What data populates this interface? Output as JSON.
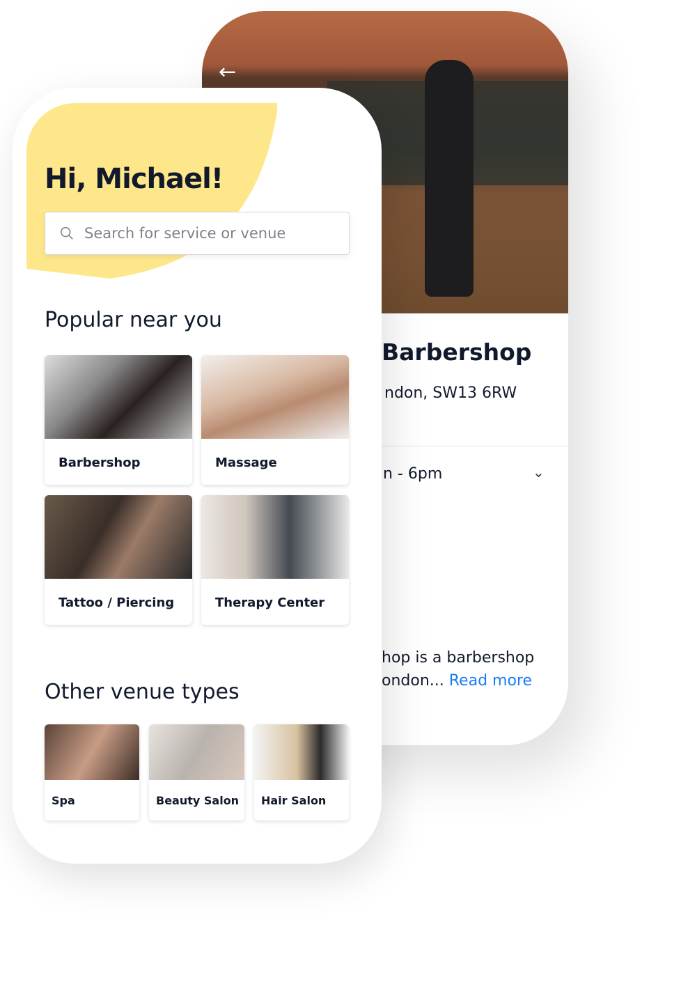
{
  "detail": {
    "title_fragment": "Barbershop",
    "address_fragment": "ndon, SW13 6RW",
    "hours_fragment": "n - 6pm",
    "desc_line1": "hop is a barbershop",
    "desc_line2": "ondon... ",
    "read_more": "Read more",
    "back_icon": "arrow-left-icon",
    "chevron_icon": "chevron-down-icon"
  },
  "home": {
    "greeting": "Hi, Michael!",
    "search_placeholder": "Search for service or venue",
    "popular_heading": "Popular near you",
    "popular": [
      {
        "label": "Barbershop"
      },
      {
        "label": "Massage"
      },
      {
        "label": "Tattoo / Piercing"
      },
      {
        "label": "Therapy Center"
      }
    ],
    "other_heading": "Other venue types",
    "other": [
      {
        "label": "Spa"
      },
      {
        "label": "Beauty Salon"
      },
      {
        "label": "Hair Salon"
      }
    ]
  },
  "colors": {
    "accent_yellow": "#fee78b",
    "link_blue": "#1a7cf5",
    "text_dark": "#111a2c"
  }
}
